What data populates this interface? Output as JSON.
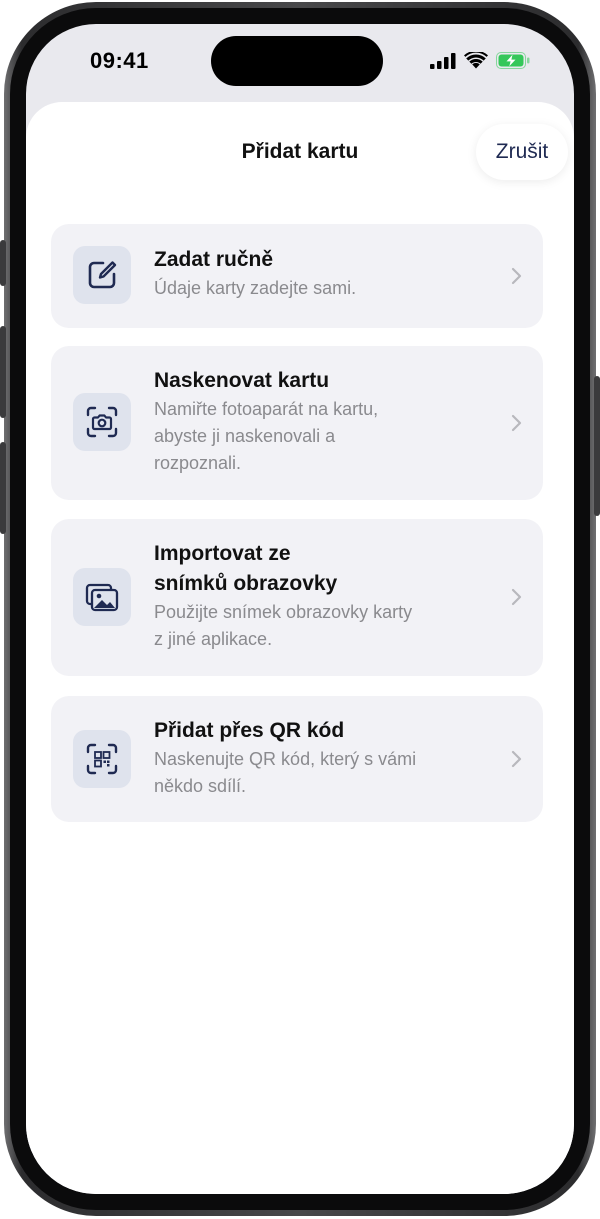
{
  "status_bar": {
    "time": "09:41"
  },
  "sheet": {
    "title": "Přidat kartu",
    "cancel_label": "Zrušit"
  },
  "options": [
    {
      "title": "Zadat ručně",
      "description": "Údaje karty zadejte sami.",
      "icon": "edit-icon"
    },
    {
      "title": "Naskenovat kartu",
      "description": "Namiřte fotoaparát na kartu,\nabyste ji naskenovali a\nrozpoznali.",
      "icon": "camera-scan-icon"
    },
    {
      "title": "Importovat ze\nsnímků obrazovky",
      "description": "Použijte snímek obrazovky karty\nz jiné aplikace.",
      "icon": "photos-icon"
    },
    {
      "title": "Přidat přes QR kód",
      "description": "Naskenujte QR kód, který s vámi\nněkdo sdílí.",
      "icon": "qr-scan-icon"
    }
  ],
  "colors": {
    "accent": "#1f2a52",
    "card_background": "#f2f2f6",
    "icon_background": "#dfe3ed",
    "battery_green": "#34c759"
  }
}
